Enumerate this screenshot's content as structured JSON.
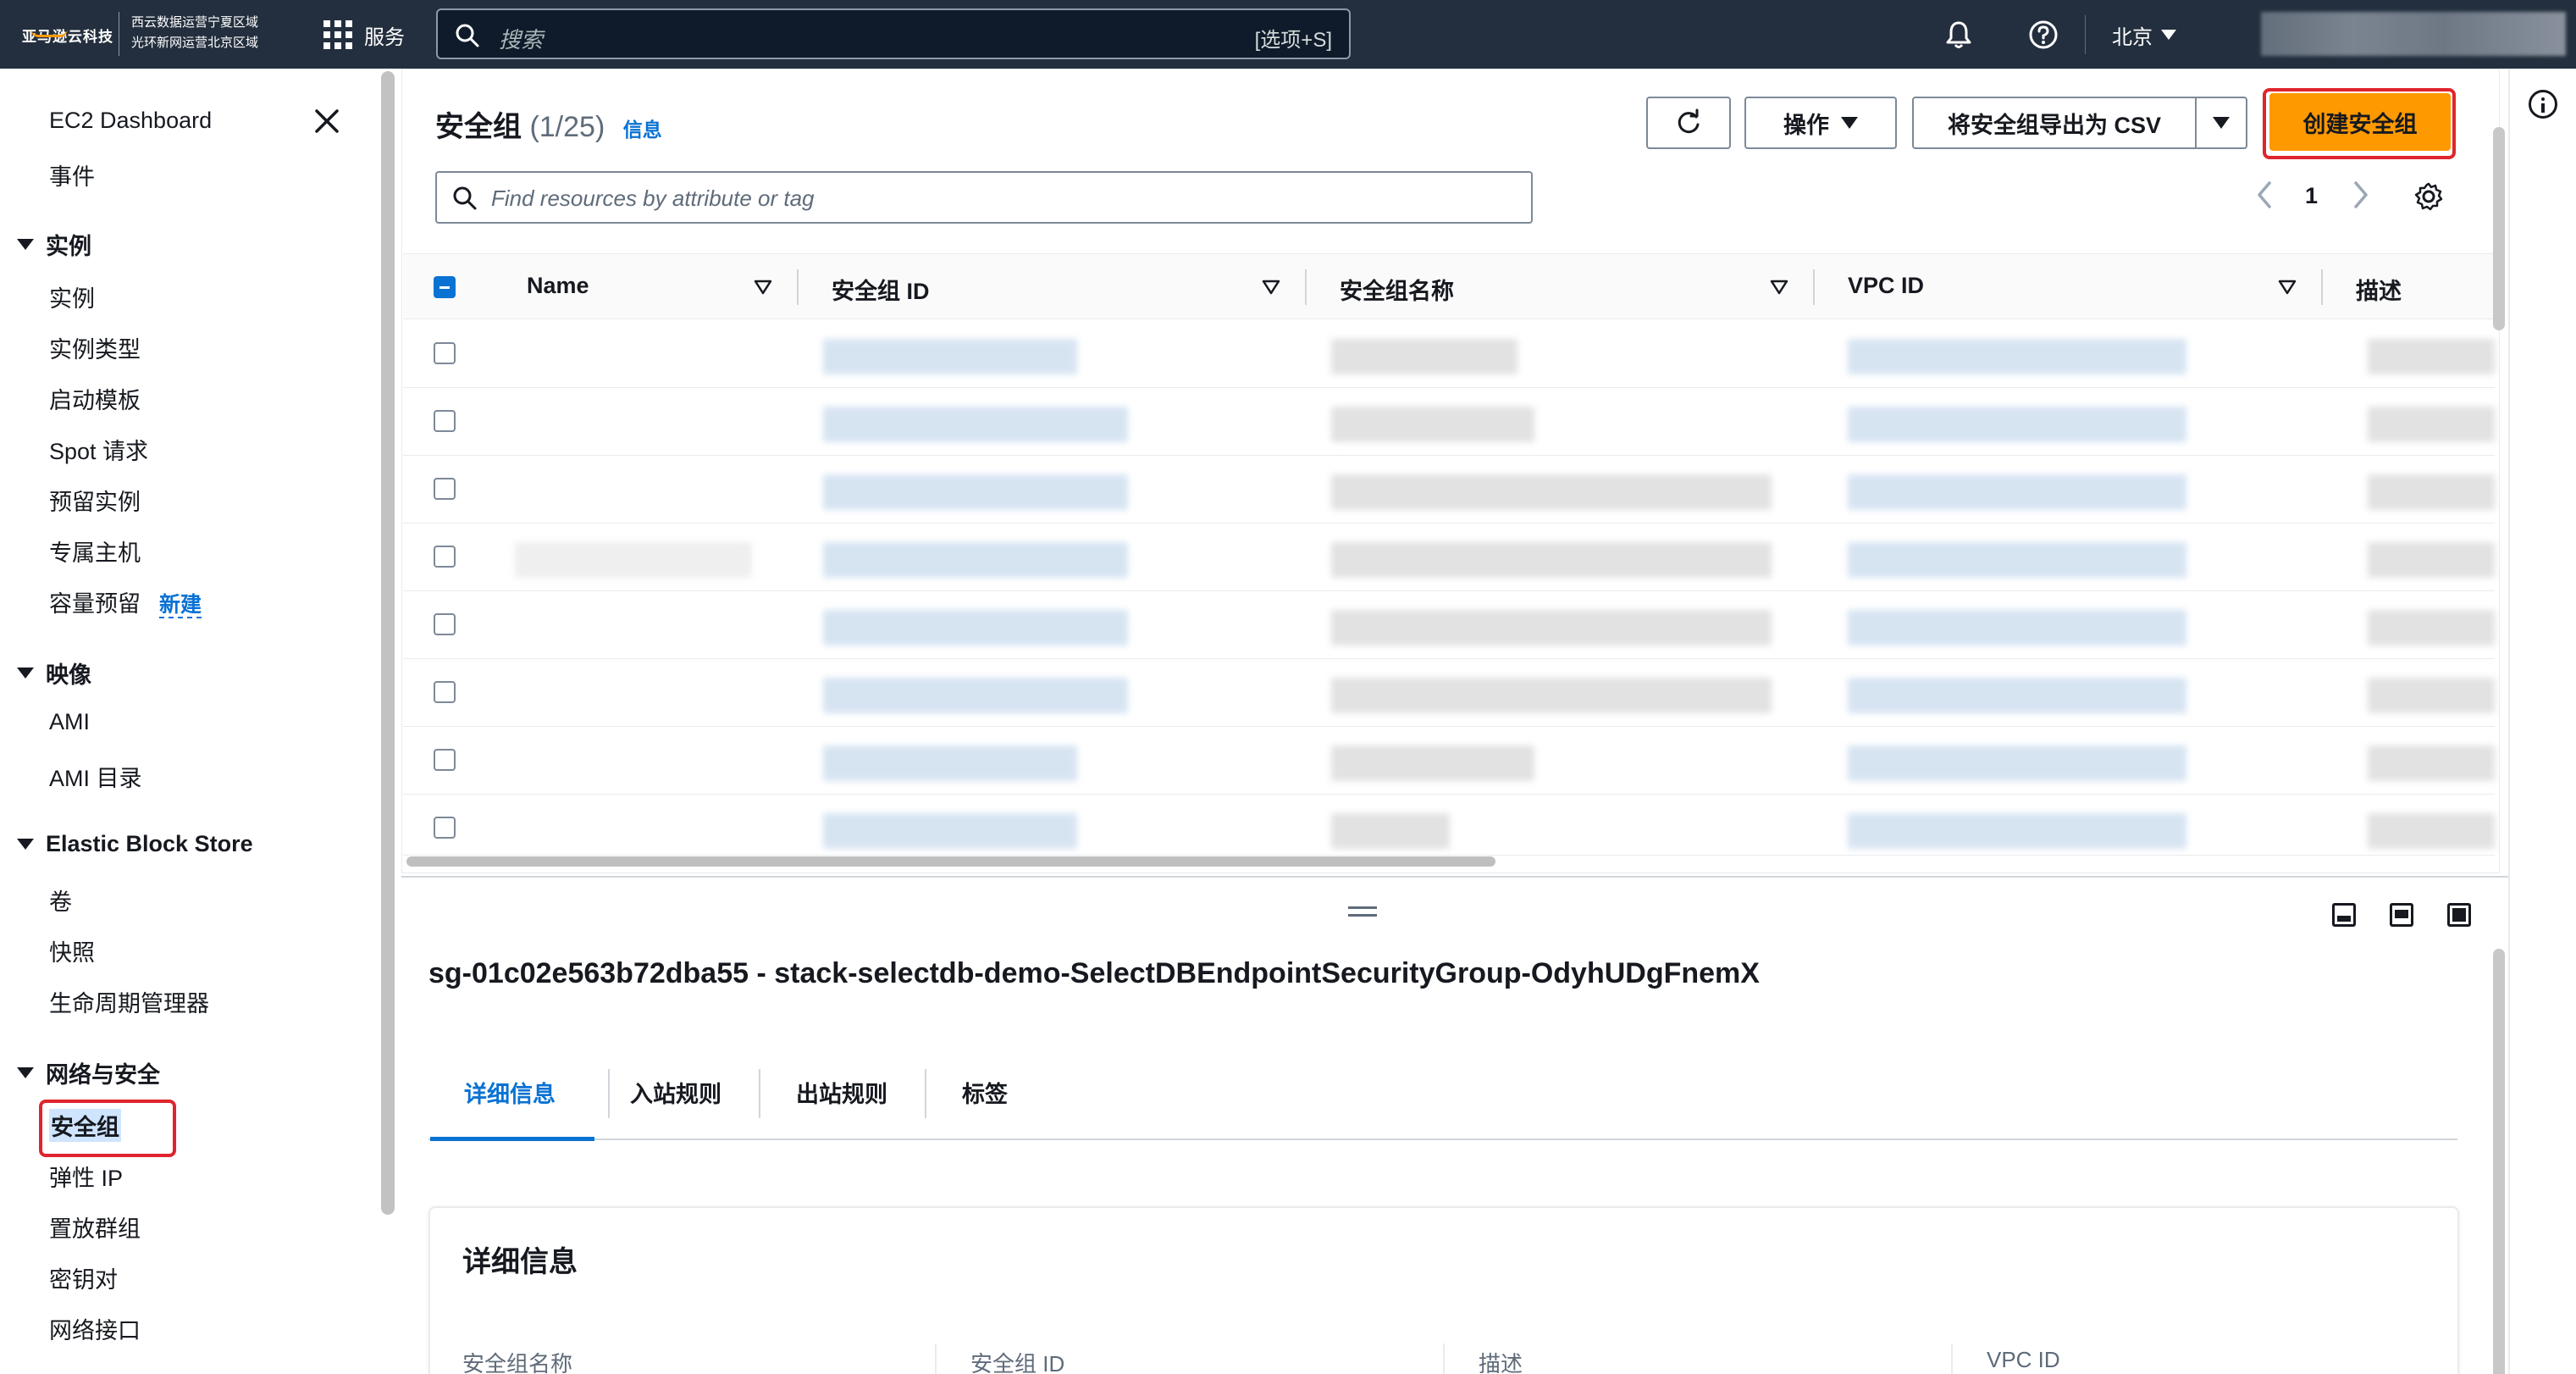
{
  "topnav": {
    "logo_text": "亚马逊云科技",
    "logo_sub_line1": "西云数据运营宁夏区域",
    "logo_sub_line2": "光环新网运营北京区域",
    "services_label": "服务",
    "search_placeholder": "搜索",
    "search_shortcut": "[选项+S]",
    "region": "北京"
  },
  "sidebar": {
    "dashboard": "EC2 Dashboard",
    "events": "事件",
    "sections": {
      "instances": {
        "title": "实例",
        "items": [
          "实例",
          "实例类型",
          "启动模板",
          "Spot 请求",
          "预留实例",
          "专属主机",
          "容量预留"
        ],
        "new_badge": "新建"
      },
      "images": {
        "title": "映像",
        "items": [
          "AMI",
          "AMI 目录"
        ]
      },
      "ebs": {
        "title": "Elastic Block Store",
        "items": [
          "卷",
          "快照",
          "生命周期管理器"
        ]
      },
      "network": {
        "title": "网络与安全",
        "items": [
          "安全组",
          "弹性 IP",
          "置放群组",
          "密钥对",
          "网络接口"
        ]
      }
    }
  },
  "main": {
    "title": "安全组",
    "count": "(1/25)",
    "info_link": "信息",
    "actions_label": "操作",
    "export_label": "将安全组导出为 CSV",
    "create_label": "创建安全组",
    "filter_placeholder": "Find resources by attribute or tag",
    "page_number": "1",
    "columns": [
      "Name",
      "安全组 ID",
      "安全组名称",
      "VPC ID",
      "描述"
    ]
  },
  "split": {
    "selected_title": "sg-01c02e563b72dba55 - stack-selectdb-demo-SelectDBEndpointSecurityGroup-OdyhUDgFnemX",
    "tabs": [
      "详细信息",
      "入站规则",
      "出站规则",
      "标签"
    ],
    "details_title": "详细信息",
    "fields": [
      "安全组名称",
      "安全组 ID",
      "描述",
      "VPC ID"
    ]
  },
  "colors": {
    "nav_bg": "#232f3e",
    "accent_orange": "#ff9900",
    "link_blue": "#0972d3",
    "highlight_red": "#e0242d"
  }
}
